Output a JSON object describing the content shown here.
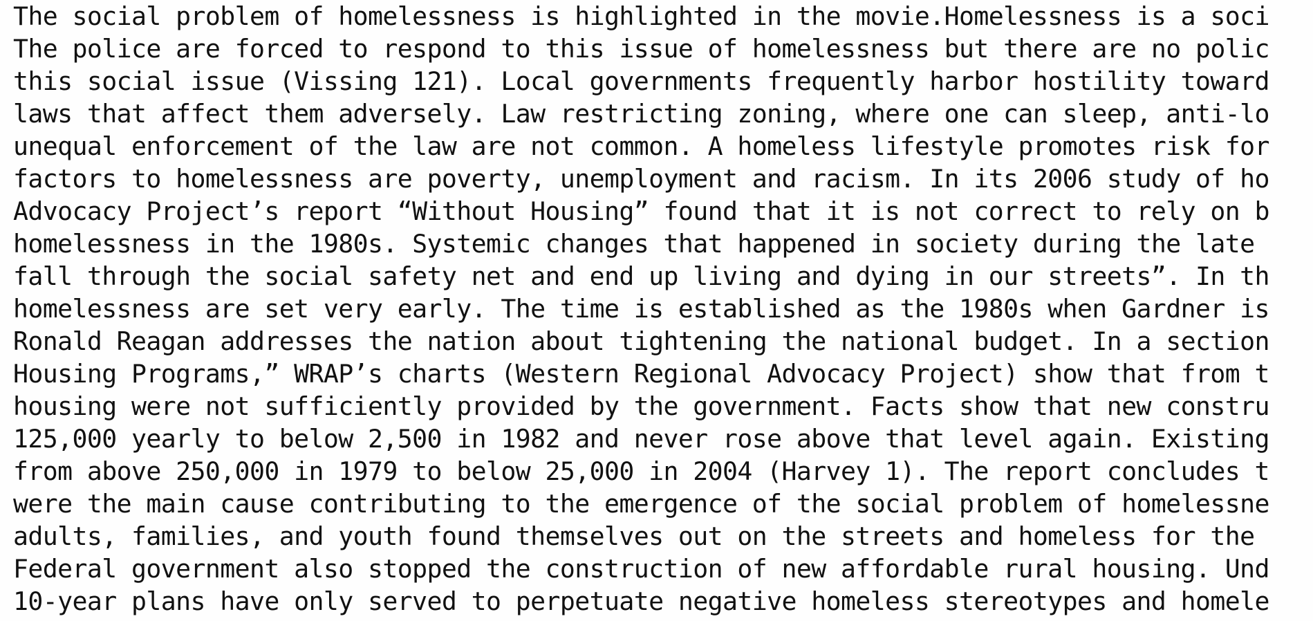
{
  "document": {
    "lines": [
      "The social problem of homelessness is highlighted in the movie.Homelessness is a soci",
      "The police are forced to respond to this issue of homelessness but there are no polic",
      "this social issue (Vissing 121). Local governments frequently harbor hostility toward",
      "laws that affect them adversely. Law restricting zoning, where one can sleep, anti-lo",
      "unequal enforcement of the law are not common. A homeless lifestyle promotes risk for",
      "factors to homelessness are poverty, unemployment and racism. In its 2006 study of ho",
      "Advocacy Project’s report “Without Housing” found that it is not correct to rely on b",
      "homelessness in the 1980s. Systemic changes that happened in society during the late",
      "fall through the social safety net and end up living and dying in our streets”. In th",
      "homelessness are set very early. The time is established as the 1980s when Gardner is",
      "Ronald Reagan addresses the nation about tightening the national budget. In a section",
      "Housing Programs,” WRAP’s charts (Western Regional Advocacy Project) show that from t",
      "housing were not sufficiently provided by the government. Facts show that new constru",
      "125,000 yearly to below 2,500 in 1982 and never rose above that level again. Existing",
      "from above 250,000 in 1979 to below 25,000 in 2004 (Harvey 1). The report concludes t",
      "were the main cause contributing to the emergence of the social problem of homelessne",
      "adults, families, and youth found themselves out on the streets and homeless for the",
      "Federal government also stopped the construction of new affordable rural housing. Und",
      "10-year plans have only served to perpetuate negative homeless stereotypes and homele"
    ]
  }
}
